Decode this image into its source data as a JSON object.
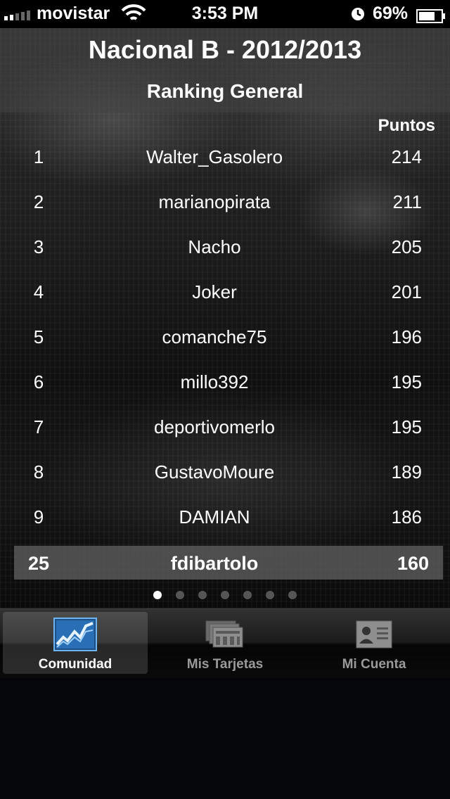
{
  "status_bar": {
    "carrier": "movistar",
    "time": "3:53 PM",
    "battery": "69%"
  },
  "header": {
    "title": "Nacional B - 2012/2013",
    "subtitle": "Ranking General"
  },
  "table": {
    "points_header": "Puntos",
    "rows": [
      {
        "position": "1",
        "name": "Walter_Gasolero",
        "points": "214"
      },
      {
        "position": "2",
        "name": "marianopirata",
        "points": "211"
      },
      {
        "position": "3",
        "name": "Nacho",
        "points": "205"
      },
      {
        "position": "4",
        "name": "Joker",
        "points": "201"
      },
      {
        "position": "5",
        "name": "comanche75",
        "points": "196"
      },
      {
        "position": "6",
        "name": "millo392",
        "points": "195"
      },
      {
        "position": "7",
        "name": "deportivomerlo",
        "points": "195"
      },
      {
        "position": "8",
        "name": "GustavoMoure",
        "points": "189"
      },
      {
        "position": "9",
        "name": "DAMIAN",
        "points": "186"
      }
    ],
    "current_user": {
      "position": "25",
      "name": "fdibartolo",
      "points": "160"
    }
  },
  "pager": {
    "pages": 7,
    "active_index": 0
  },
  "tab_bar": {
    "tabs": [
      {
        "label": "Comunidad",
        "icon": "chart-icon",
        "selected": true
      },
      {
        "label": "Mis Tarjetas",
        "icon": "cards-icon",
        "selected": false
      },
      {
        "label": "Mi Cuenta",
        "icon": "id-card-icon",
        "selected": false
      }
    ]
  },
  "colors": {
    "selected_tab_icon": "#4a9fe0",
    "inactive_tab_icon": "#8a8a8a"
  }
}
